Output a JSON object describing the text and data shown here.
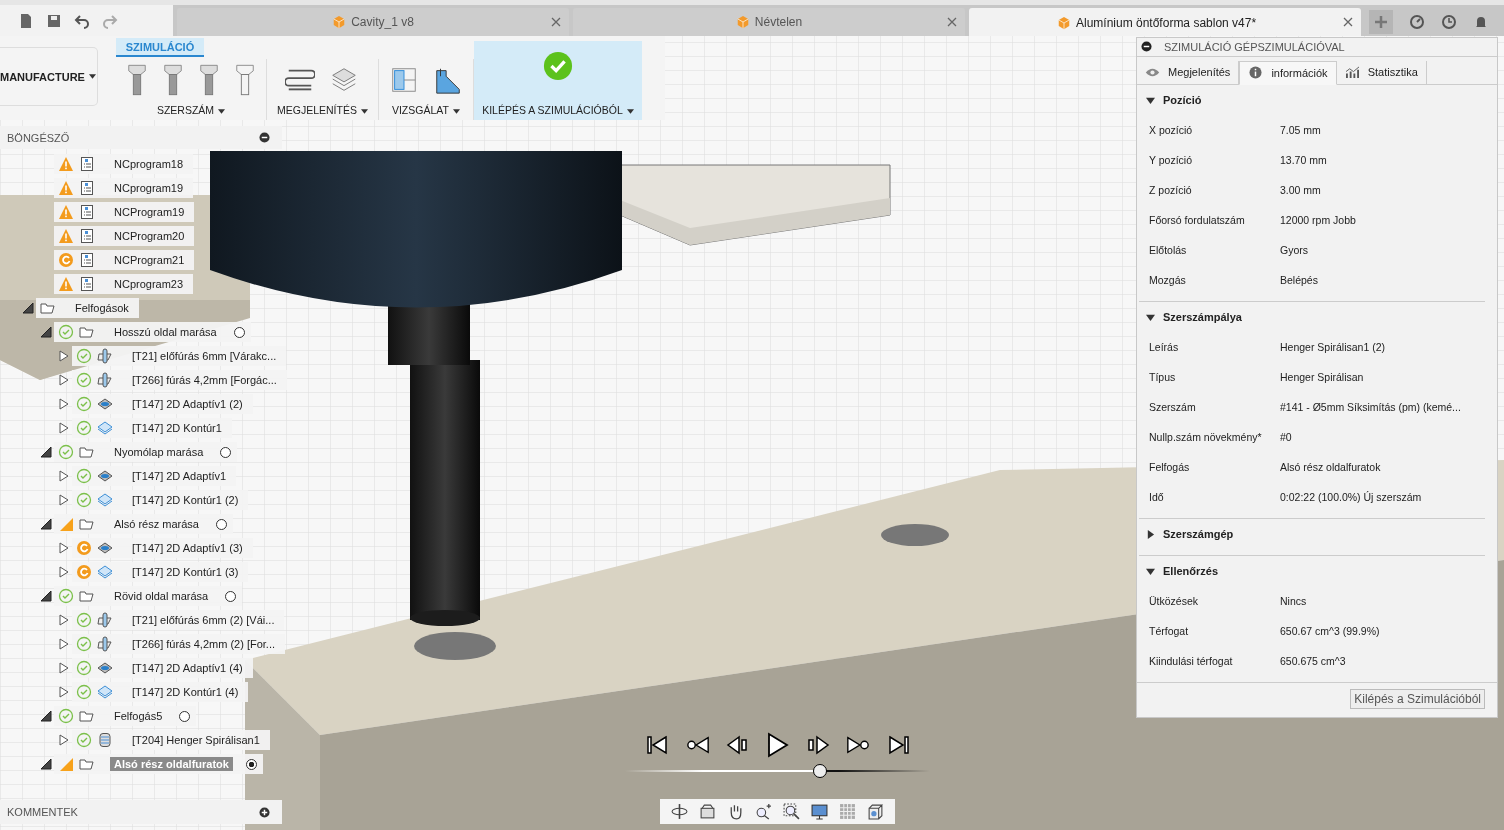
{
  "document_tabs": [
    {
      "title": "Cavity_1 v8",
      "selected": false
    },
    {
      "title": "Névtelen",
      "selected": false
    },
    {
      "title": "Alumínium öntőforma sablon v47*",
      "selected": true
    }
  ],
  "workspace": {
    "label": "MANUFACTURE"
  },
  "ribbon": {
    "tab": {
      "label": "SZIMULÁCIÓ",
      "selected": true
    },
    "groups": [
      {
        "label": "SZERSZÁM",
        "kind": "tools"
      },
      {
        "label": "MEGJELENÍTÉS",
        "kind": "display"
      },
      {
        "label": "VIZSGÁLAT",
        "kind": "inspect"
      },
      {
        "label": "KILÉPÉS A SZIMULÁCIÓBÓL",
        "kind": "exit"
      }
    ]
  },
  "browser": {
    "title": "BÖNGÉSZŐ",
    "nc_programs": [
      {
        "name": "NCprogram18",
        "status": {
          "kind": "warning"
        }
      },
      {
        "name": "NCprogram19",
        "status": {
          "kind": "warning"
        }
      },
      {
        "name": "NCProgram19",
        "status": {
          "kind": "warning"
        }
      },
      {
        "name": "NCProgram20",
        "status": {
          "kind": "warning"
        }
      },
      {
        "name": "NCProgram21",
        "status": {
          "kind": "pending"
        }
      },
      {
        "name": "NCprogram23",
        "status": {
          "kind": "warning"
        }
      }
    ],
    "tree": [
      {
        "name": "Felfogások",
        "kind": "folder",
        "expanded": true,
        "selected": false,
        "children": [
          {
            "name": "Hosszú oldal marása",
            "kind": "setup",
            "status": {
              "kind": "ok"
            },
            "expanded": true,
            "selected": false,
            "active": false,
            "children": [
              {
                "name": "[T21] előfúrás 6mm [Várakc...",
                "kind": "drill",
                "status": {
                  "kind": "ok"
                },
                "expanded": false,
                "selected": false
              },
              {
                "name": "[T266] fúrás 4,2mm [Forgác...",
                "kind": "drill",
                "status": {
                  "kind": "ok"
                },
                "expanded": false,
                "selected": false
              },
              {
                "name": "[T147] 2D Adaptív1 (2)",
                "kind": "adaptive",
                "status": {
                  "kind": "ok"
                },
                "expanded": false,
                "selected": false
              },
              {
                "name": "[T147] 2D Kontúr1",
                "kind": "contour",
                "status": {
                  "kind": "ok"
                },
                "expanded": false,
                "selected": false
              }
            ]
          },
          {
            "name": "Nyomólap marása",
            "kind": "setup",
            "status": {
              "kind": "ok"
            },
            "expanded": true,
            "selected": false,
            "active": false,
            "children": [
              {
                "name": "[T147] 2D Adaptív1",
                "kind": "adaptive",
                "status": {
                  "kind": "ok"
                },
                "expanded": false,
                "selected": false
              },
              {
                "name": "[T147] 2D Kontúr1 (2)",
                "kind": "contour",
                "status": {
                  "kind": "ok"
                },
                "expanded": false,
                "selected": false
              }
            ]
          },
          {
            "name": "Alsó rész marása",
            "kind": "setup",
            "status": {
              "kind": "partial"
            },
            "expanded": true,
            "selected": false,
            "active": false,
            "children": [
              {
                "name": "[T147] 2D Adaptív1 (3)",
                "kind": "adaptive",
                "status": {
                  "kind": "pending"
                },
                "expanded": false,
                "selected": false
              },
              {
                "name": "[T147] 2D Kontúr1 (3)",
                "kind": "contour",
                "status": {
                  "kind": "pending"
                },
                "expanded": false,
                "selected": false
              }
            ]
          },
          {
            "name": "Rövid oldal marása",
            "kind": "setup",
            "status": {
              "kind": "ok"
            },
            "expanded": true,
            "selected": false,
            "active": false,
            "children": [
              {
                "name": "[T21] előfúrás 6mm (2) [Vái...",
                "kind": "drill",
                "status": {
                  "kind": "ok"
                },
                "expanded": false,
                "selected": false
              },
              {
                "name": "[T266] fúrás 4,2mm (2) [For...",
                "kind": "drill",
                "status": {
                  "kind": "ok"
                },
                "expanded": false,
                "selected": false
              },
              {
                "name": "[T147] 2D Adaptív1 (4)",
                "kind": "adaptive",
                "status": {
                  "kind": "ok"
                },
                "expanded": false,
                "selected": false
              },
              {
                "name": "[T147] 2D Kontúr1 (4)",
                "kind": "contour",
                "status": {
                  "kind": "ok"
                },
                "expanded": false,
                "selected": false
              }
            ]
          },
          {
            "name": "Felfogás5",
            "kind": "setup",
            "status": {
              "kind": "ok"
            },
            "expanded": true,
            "selected": false,
            "active": false,
            "children": [
              {
                "name": "[T204] Henger Spirálisan1",
                "kind": "bore",
                "status": {
                  "kind": "ok"
                },
                "expanded": false,
                "selected": false
              }
            ]
          },
          {
            "name": "Alsó rész oldalfuratok",
            "kind": "setup",
            "status": {
              "kind": "partial"
            },
            "expanded": true,
            "selected": true,
            "active": true
          }
        ]
      }
    ]
  },
  "comments": {
    "title": "KOMMENTEK"
  },
  "sim_panel": {
    "title": "SZIMULÁCIÓ GÉPSZIMULÁCIÓVAL",
    "tabs": [
      {
        "label": "Megjelenítés",
        "kind": "eye",
        "selected": false
      },
      {
        "label": "információk",
        "kind": "info",
        "selected": true
      },
      {
        "label": "Statisztika",
        "kind": "chart",
        "selected": false
      }
    ],
    "sections": [
      {
        "title": "Pozíció",
        "expanded": true,
        "rows": [
          {
            "label": "X pozíció",
            "value": "7.05 mm"
          },
          {
            "label": "Y pozíció",
            "value": "13.70 mm"
          },
          {
            "label": "Z pozíció",
            "value": "3.00 mm"
          },
          {
            "label": "Főorsó fordulatszám",
            "value": "12000 rpm Jobb"
          },
          {
            "label": "Előtolás",
            "value": "Gyors"
          },
          {
            "label": "Mozgás",
            "value": "Belépés"
          }
        ]
      },
      {
        "title": "Szerszámpálya",
        "expanded": true,
        "rows": [
          {
            "label": "Leírás",
            "value": "Henger Spirálisan1 (2)"
          },
          {
            "label": "Típus",
            "value": "Henger Spirálisan"
          },
          {
            "label": "Szerszám",
            "value": "#141 - Ø5mm Síksimítás (pm) (kemé..."
          },
          {
            "label": "Nullp.szám növekmény*",
            "value": "#0"
          },
          {
            "label": "Felfogás",
            "value": "Alsó rész oldalfuratok"
          },
          {
            "label": "Idő",
            "value": "0:02:22 (100.0%) Új szerszám"
          }
        ]
      },
      {
        "title": "Szerszámgép",
        "expanded": false
      },
      {
        "title": "Ellenőrzés",
        "expanded": true,
        "rows": [
          {
            "label": "Ütközések",
            "value": "Nincs"
          },
          {
            "label": "Térfogat",
            "value": "650.67 cm^3 (99.9%)"
          },
          {
            "label": "Kiindulási térfogat",
            "value": "650.675 cm^3"
          }
        ]
      }
    ],
    "button": "Kilépés a Szimulációból"
  },
  "playback": {
    "level": 0.64
  }
}
